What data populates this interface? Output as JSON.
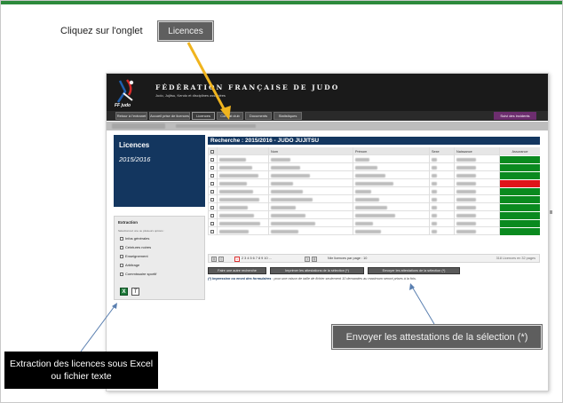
{
  "annotations": {
    "instruction": "Cliquez sur l'onglet",
    "tab_callout": "Licences",
    "send_callout": "Envoyer les attestations de la sélection (*)",
    "extract_callout": "Extraction des licences sous Excel ou fichier texte"
  },
  "header": {
    "federation_name": "FÉDÉRATION FRANÇAISE DE JUDO",
    "federation_sub": "Judo, Jujitsu, Kendo et disciplines associées",
    "logo_text": "FF judo"
  },
  "nav": {
    "items": [
      "Retour à l'extranet",
      "Accueil prise de licences",
      "Licences",
      "Contrat club",
      "Documents",
      "Statistiques"
    ],
    "suivi": "Suivi des incidents"
  },
  "sidebar": {
    "title": "Licences",
    "season": "2015/2016"
  },
  "extraction": {
    "title": "Extraction",
    "help": "Sélectionnez une ou plusieurs options :",
    "options": [
      "Infos générales",
      "Ceintures noires",
      "Enseignement",
      "Arbitrage",
      "Commissaire sportif"
    ],
    "excel_icon": "excel-icon",
    "text_icon": "text-file-icon"
  },
  "search": {
    "title": "Recherche : 2015/2016 - JUDO JUJITSU",
    "columns": [
      "Nom",
      "Prénom",
      "Sexe",
      "Naissance",
      "Assurance"
    ],
    "insurance": [
      "green",
      "green",
      "green",
      "red",
      "green",
      "green",
      "green",
      "green",
      "green",
      "green"
    ]
  },
  "pager": {
    "current": "1",
    "pages": "2 3 4 5 6 7 8 9 10 ...",
    "per_page": "Nbr licences par page : 10",
    "total": "318 Licences en 32 pages"
  },
  "actions": {
    "new_search": "Faire une autre recherche",
    "print": "Imprimer les attestations de la sélection (*)",
    "send": "Envoyer les attestations de la sélection (*)"
  },
  "note": {
    "bold": "(*) Impression ou envoi des formulaires",
    "text": " : pour une raison de taille de fichier seulement 10 demandes au maximum seront prises à la fois."
  },
  "colors": {
    "navy": "#13365f",
    "green": "#0a8a1f",
    "red": "#e0141a",
    "arrow_yellow": "#f0b41e",
    "arrow_blue": "#5a7fb0"
  }
}
